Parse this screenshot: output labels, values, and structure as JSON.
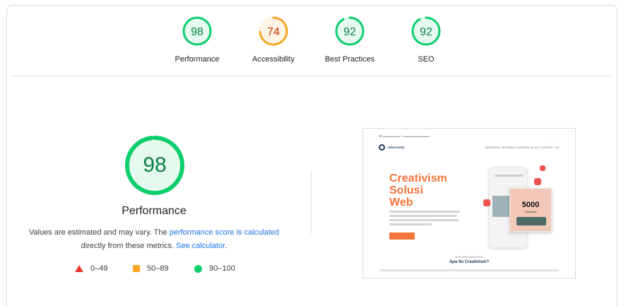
{
  "summary": {
    "gauges": [
      {
        "id": "performance",
        "score": "98",
        "label": "Performance",
        "score_value": 98,
        "status": "pass",
        "color": "#0cce6b",
        "text_color": "#0b8043",
        "fill": "#e6f9ef"
      },
      {
        "id": "accessibility",
        "score": "74",
        "label": "Accessibility",
        "score_value": 74,
        "status": "average",
        "color": "#f4a623",
        "text_color": "#c33300",
        "fill": "#fff5e6"
      },
      {
        "id": "best-practices",
        "score": "92",
        "label": "Best Practices",
        "score_value": 92,
        "status": "pass",
        "color": "#0cce6b",
        "text_color": "#0b8043",
        "fill": "#e6f9ef"
      },
      {
        "id": "seo",
        "score": "92",
        "label": "SEO",
        "score_value": 92,
        "status": "pass",
        "color": "#0cce6b",
        "text_color": "#0b8043",
        "fill": "#e6f9ef"
      }
    ]
  },
  "performance": {
    "score": "98",
    "score_value": 98,
    "title": "Performance",
    "desc_prefix": "Values are estimated and may vary. The ",
    "link_calc": "performance score is calculated",
    "desc_middle": "directly from these metrics. ",
    "link_calculator": "See calculator",
    "desc_suffix": "."
  },
  "legend": {
    "fail": "0–49",
    "average": "50–89",
    "pass": "90–100"
  },
  "colors": {
    "pass": "#0cce6b",
    "average": "#f4a623",
    "fail": "#e53935",
    "link": "#1a73e8",
    "accent_orange": "#f4743b"
  },
  "thumbnail": {
    "hero_line1": "Creativism",
    "hero_line2": "Solusi",
    "hero_line3": "Web",
    "counter": "5000",
    "counter_label": "Followers",
    "subtitle": "MENGAPA CREATIVISM",
    "heading": "Apa Itu Creativism?",
    "logo_text": "CREATIVISM",
    "nav": "BERANDA   TENTANG   LAYANAN   BLOG   CONTACT US"
  }
}
